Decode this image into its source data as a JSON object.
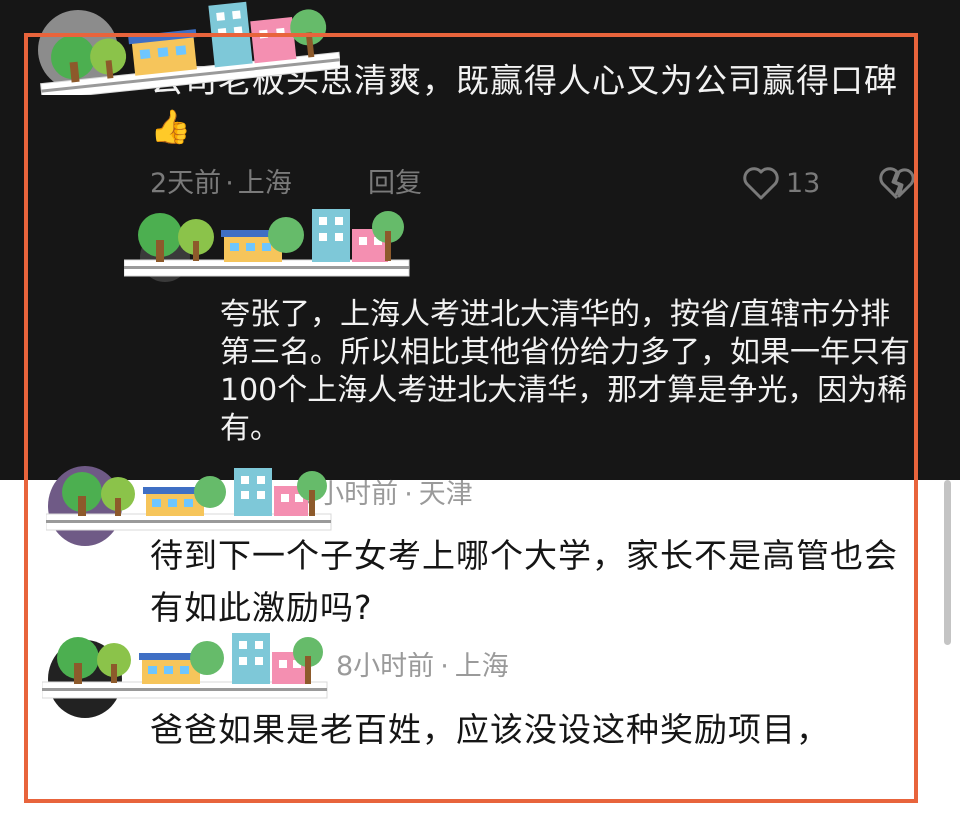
{
  "colors": {
    "dark_bg": "#161616",
    "light_bg": "#ffffff",
    "frame": "#e8643c",
    "meta_grey": "#7a7a7a"
  },
  "comments": [
    {
      "text": "公司老板头思清爽，既赢得人心又为公司赢得口碑",
      "emoji": "👍",
      "time": "2天前",
      "sep": "·",
      "location": "上海",
      "reply_label": "回复",
      "like_icon": "heart-icon",
      "like_count": "13",
      "dislike_icon": "broken-heart-icon"
    },
    {
      "text": "夸张了，上海人考进北大清华的，按省/直辖市分排第三名。所以相比其他省份给力多了，如果一年只有100个上海人考进北大清华，那才算是争光，因为稀有。"
    },
    {
      "time": "2小时前",
      "sep": "·",
      "location": "天津",
      "text": "待到下一个子女考上哪个大学，家长不是高管也会有如此激励吗?"
    },
    {
      "time": "8小时前",
      "sep": "·",
      "location": "上海",
      "text": "爸爸如果是老百姓，应该没设这种奖励项目，"
    }
  ]
}
